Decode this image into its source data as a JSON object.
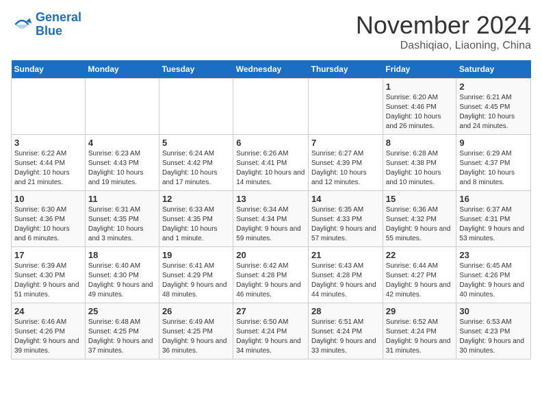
{
  "header": {
    "logo_line1": "General",
    "logo_line2": "Blue",
    "month_title": "November 2024",
    "location": "Dashiqiao, Liaoning, China"
  },
  "weekdays": [
    "Sunday",
    "Monday",
    "Tuesday",
    "Wednesday",
    "Thursday",
    "Friday",
    "Saturday"
  ],
  "weeks": [
    [
      {
        "day": "",
        "info": ""
      },
      {
        "day": "",
        "info": ""
      },
      {
        "day": "",
        "info": ""
      },
      {
        "day": "",
        "info": ""
      },
      {
        "day": "",
        "info": ""
      },
      {
        "day": "1",
        "info": "Sunrise: 6:20 AM\nSunset: 4:46 PM\nDaylight: 10 hours and 26 minutes."
      },
      {
        "day": "2",
        "info": "Sunrise: 6:21 AM\nSunset: 4:45 PM\nDaylight: 10 hours and 24 minutes."
      }
    ],
    [
      {
        "day": "3",
        "info": "Sunrise: 6:22 AM\nSunset: 4:44 PM\nDaylight: 10 hours and 21 minutes."
      },
      {
        "day": "4",
        "info": "Sunrise: 6:23 AM\nSunset: 4:43 PM\nDaylight: 10 hours and 19 minutes."
      },
      {
        "day": "5",
        "info": "Sunrise: 6:24 AM\nSunset: 4:42 PM\nDaylight: 10 hours and 17 minutes."
      },
      {
        "day": "6",
        "info": "Sunrise: 6:26 AM\nSunset: 4:41 PM\nDaylight: 10 hours and 14 minutes."
      },
      {
        "day": "7",
        "info": "Sunrise: 6:27 AM\nSunset: 4:39 PM\nDaylight: 10 hours and 12 minutes."
      },
      {
        "day": "8",
        "info": "Sunrise: 6:28 AM\nSunset: 4:38 PM\nDaylight: 10 hours and 10 minutes."
      },
      {
        "day": "9",
        "info": "Sunrise: 6:29 AM\nSunset: 4:37 PM\nDaylight: 10 hours and 8 minutes."
      }
    ],
    [
      {
        "day": "10",
        "info": "Sunrise: 6:30 AM\nSunset: 4:36 PM\nDaylight: 10 hours and 6 minutes."
      },
      {
        "day": "11",
        "info": "Sunrise: 6:31 AM\nSunset: 4:35 PM\nDaylight: 10 hours and 3 minutes."
      },
      {
        "day": "12",
        "info": "Sunrise: 6:33 AM\nSunset: 4:35 PM\nDaylight: 10 hours and 1 minute."
      },
      {
        "day": "13",
        "info": "Sunrise: 6:34 AM\nSunset: 4:34 PM\nDaylight: 9 hours and 59 minutes."
      },
      {
        "day": "14",
        "info": "Sunrise: 6:35 AM\nSunset: 4:33 PM\nDaylight: 9 hours and 57 minutes."
      },
      {
        "day": "15",
        "info": "Sunrise: 6:36 AM\nSunset: 4:32 PM\nDaylight: 9 hours and 55 minutes."
      },
      {
        "day": "16",
        "info": "Sunrise: 6:37 AM\nSunset: 4:31 PM\nDaylight: 9 hours and 53 minutes."
      }
    ],
    [
      {
        "day": "17",
        "info": "Sunrise: 6:39 AM\nSunset: 4:30 PM\nDaylight: 9 hours and 51 minutes."
      },
      {
        "day": "18",
        "info": "Sunrise: 6:40 AM\nSunset: 4:30 PM\nDaylight: 9 hours and 49 minutes."
      },
      {
        "day": "19",
        "info": "Sunrise: 6:41 AM\nSunset: 4:29 PM\nDaylight: 9 hours and 48 minutes."
      },
      {
        "day": "20",
        "info": "Sunrise: 6:42 AM\nSunset: 4:28 PM\nDaylight: 9 hours and 46 minutes."
      },
      {
        "day": "21",
        "info": "Sunrise: 6:43 AM\nSunset: 4:28 PM\nDaylight: 9 hours and 44 minutes."
      },
      {
        "day": "22",
        "info": "Sunrise: 6:44 AM\nSunset: 4:27 PM\nDaylight: 9 hours and 42 minutes."
      },
      {
        "day": "23",
        "info": "Sunrise: 6:45 AM\nSunset: 4:26 PM\nDaylight: 9 hours and 40 minutes."
      }
    ],
    [
      {
        "day": "24",
        "info": "Sunrise: 6:46 AM\nSunset: 4:26 PM\nDaylight: 9 hours and 39 minutes."
      },
      {
        "day": "25",
        "info": "Sunrise: 6:48 AM\nSunset: 4:25 PM\nDaylight: 9 hours and 37 minutes."
      },
      {
        "day": "26",
        "info": "Sunrise: 6:49 AM\nSunset: 4:25 PM\nDaylight: 9 hours and 36 minutes."
      },
      {
        "day": "27",
        "info": "Sunrise: 6:50 AM\nSunset: 4:24 PM\nDaylight: 9 hours and 34 minutes."
      },
      {
        "day": "28",
        "info": "Sunrise: 6:51 AM\nSunset: 4:24 PM\nDaylight: 9 hours and 33 minutes."
      },
      {
        "day": "29",
        "info": "Sunrise: 6:52 AM\nSunset: 4:24 PM\nDaylight: 9 hours and 31 minutes."
      },
      {
        "day": "30",
        "info": "Sunrise: 6:53 AM\nSunset: 4:23 PM\nDaylight: 9 hours and 30 minutes."
      }
    ]
  ]
}
